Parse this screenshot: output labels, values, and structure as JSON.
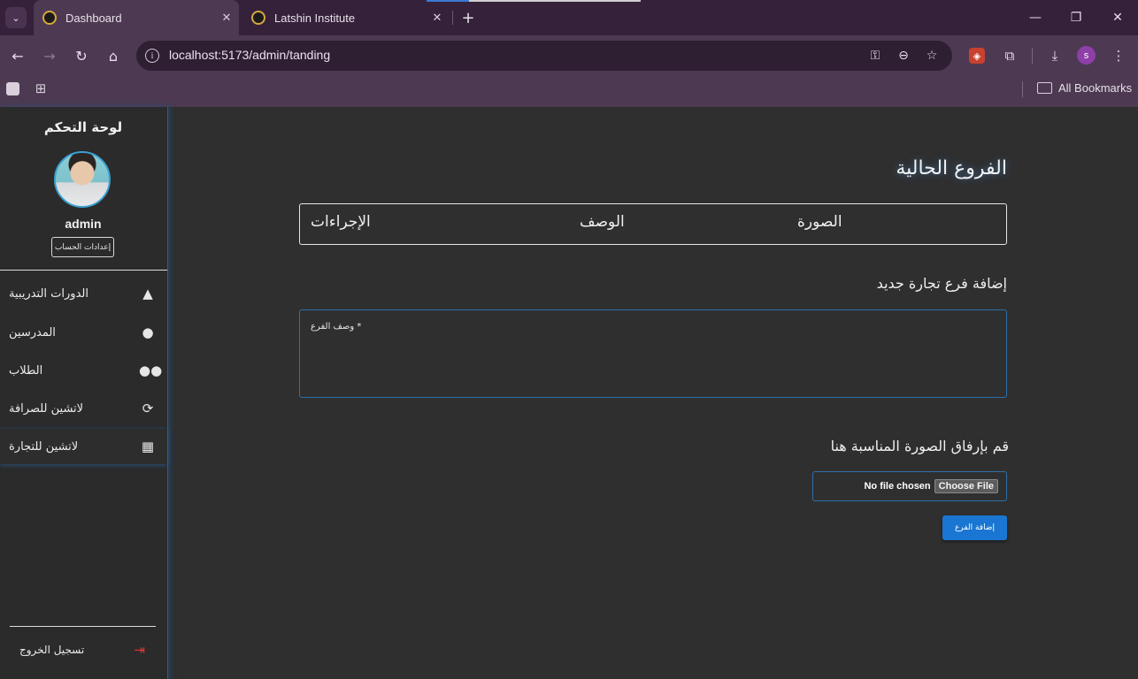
{
  "browser": {
    "tabs": [
      {
        "title": "Dashboard",
        "close": "✕"
      },
      {
        "title": "Latshin Institute",
        "close": "✕"
      }
    ],
    "new_tab": "+",
    "url": "localhost:5173/admin/tanding",
    "profile_initial": "s",
    "bookmarks_label": "All Bookmarks",
    "window_controls": [
      "—",
      "❐",
      "✕"
    ]
  },
  "sidebar": {
    "title": "لوحة التحكم",
    "username": "admin",
    "settings_button": "إعدادات الحساب",
    "items": [
      {
        "label": "الدورات التدريبية",
        "icon": "graduation-cap-icon",
        "glyph": "🎓"
      },
      {
        "label": "المدرسين",
        "icon": "person-icon",
        "glyph": "👤"
      },
      {
        "label": "الطلاب",
        "icon": "group-icon",
        "glyph": "👥"
      },
      {
        "label": "لاتشين للصرافة",
        "icon": "currency-exchange-icon",
        "glyph": "⟳"
      },
      {
        "label": "لاتشين للتجارة",
        "icon": "building-icon",
        "glyph": "▦"
      }
    ],
    "active_index": 4,
    "logout_label": "تسجيل الخروج"
  },
  "main": {
    "title": "الفروع الحالية",
    "table_headers": [
      "الصورة",
      "الوصف",
      "الإجراءات"
    ],
    "form_title": "إضافة فرع تجارة جديد",
    "description_label": "وصف الفرع *",
    "upload_title": "قم بإرفاق الصورة المناسبة هنا",
    "file_status": "No file chosen",
    "file_button": "Choose File",
    "submit_button": "إضافة الفرع"
  },
  "colors": {
    "accent": "#1976d2",
    "sidebar_glow": "#2f6fa8",
    "logout_icon": "#e2342e",
    "chrome_bg": "#4d3a52"
  }
}
